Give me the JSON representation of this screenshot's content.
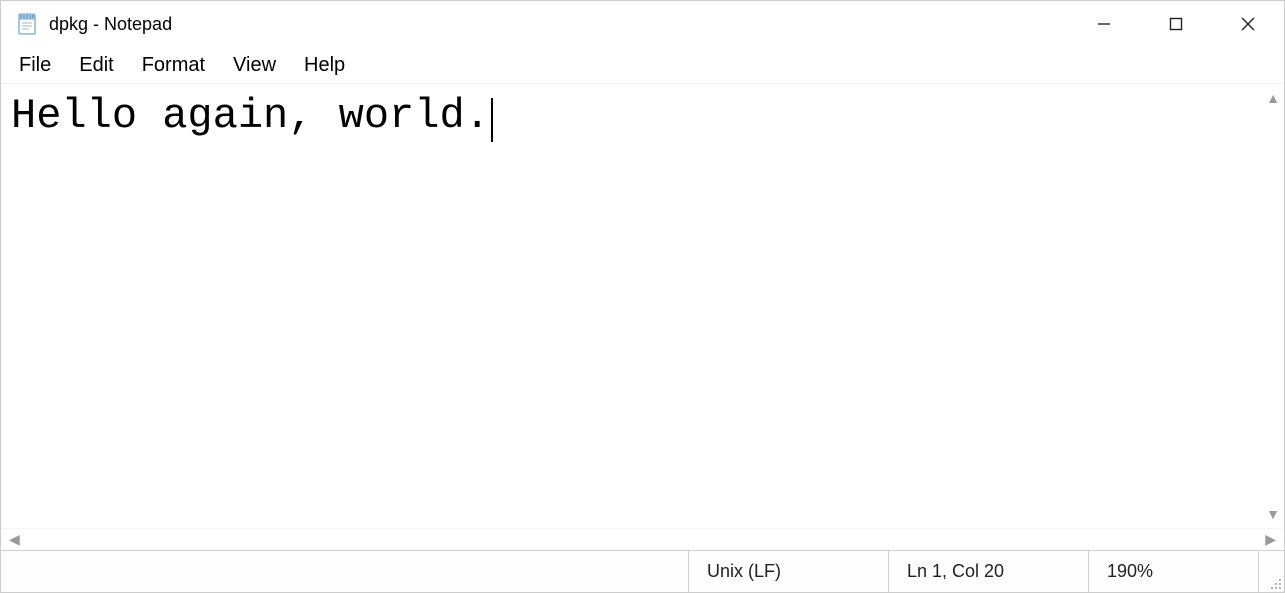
{
  "titlebar": {
    "title": "dpkg - Notepad"
  },
  "menu": {
    "items": [
      "File",
      "Edit",
      "Format",
      "View",
      "Help"
    ]
  },
  "editor": {
    "content": "Hello again, world."
  },
  "status": {
    "eol": "Unix (LF)",
    "position": "Ln 1, Col 20",
    "zoom": "190%"
  }
}
